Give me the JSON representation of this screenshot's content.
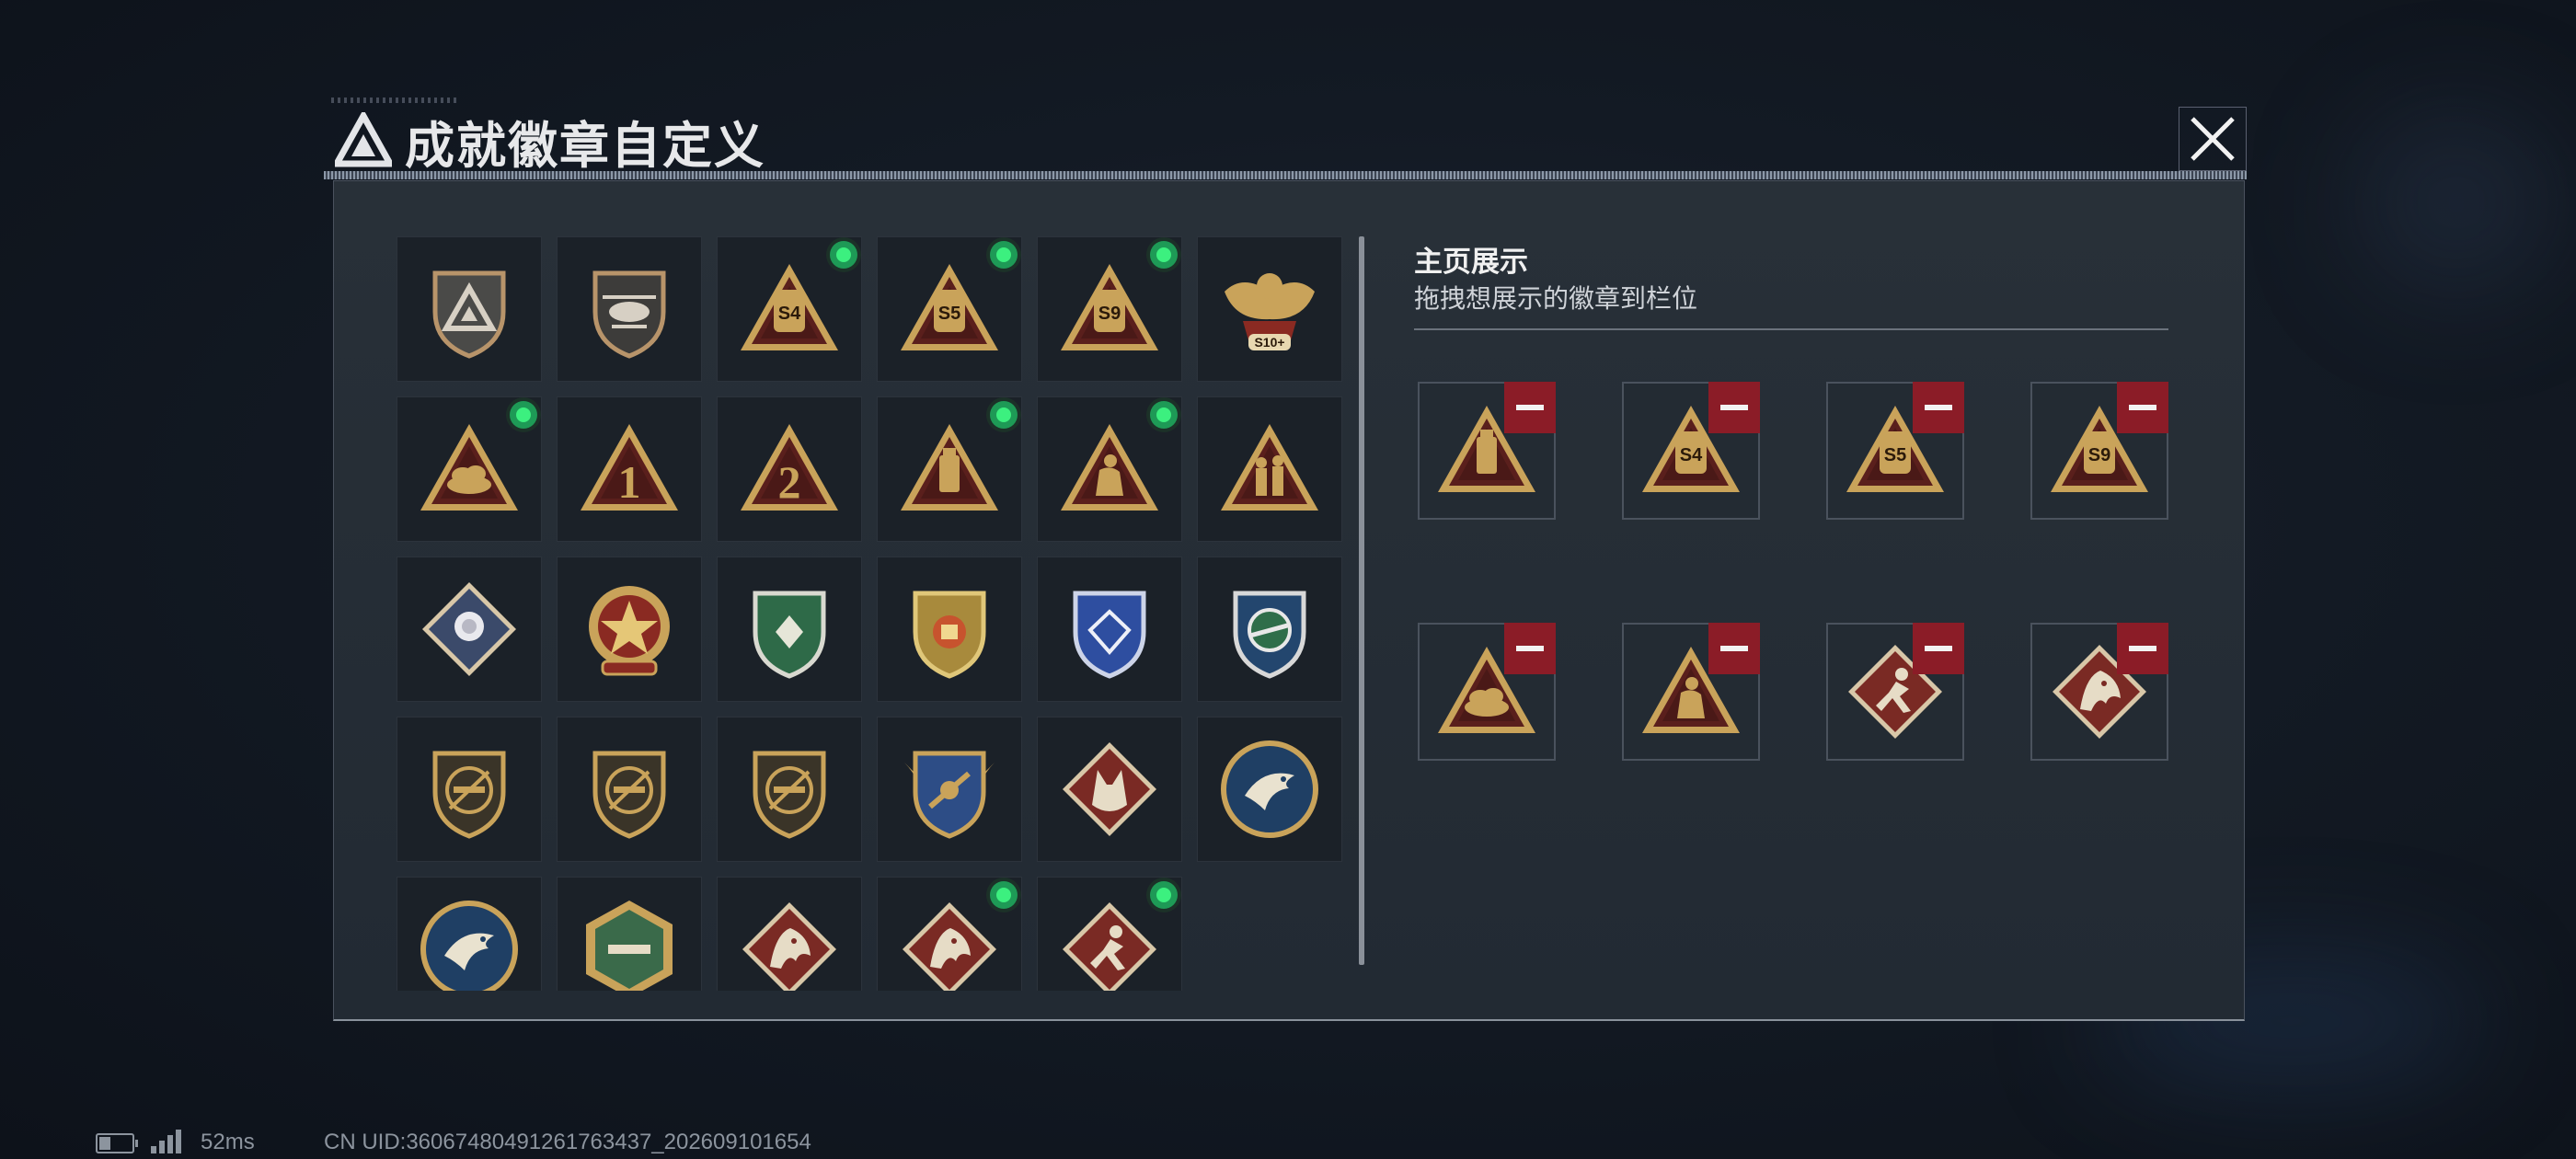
{
  "window": {
    "title": "成就徽章自定义",
    "close_icon": "close-icon"
  },
  "badges": [
    {
      "icon": "shield-logo-badge",
      "new": false
    },
    {
      "icon": "helicopter-shield-badge",
      "new": false
    },
    {
      "icon": "s4-triangle-badge",
      "new": true,
      "label": "S4"
    },
    {
      "icon": "s5-triangle-badge",
      "new": true,
      "label": "S5"
    },
    {
      "icon": "s9-triangle-badge",
      "new": true,
      "label": "S9"
    },
    {
      "icon": "eagle-s10-badge",
      "new": false,
      "label": "S10+"
    },
    {
      "icon": "gold-pile-triangle-badge",
      "new": true
    },
    {
      "icon": "number-one-triangle-badge",
      "new": false,
      "label": "1"
    },
    {
      "icon": "number-two-triangle-badge",
      "new": false,
      "label": "2"
    },
    {
      "icon": "usb-triangle-badge",
      "new": true
    },
    {
      "icon": "crouching-figure-triangle-badge",
      "new": true
    },
    {
      "icon": "soldiers-triangle-badge",
      "new": false
    },
    {
      "icon": "white-rose-diamond-badge",
      "new": false
    },
    {
      "icon": "star-medal-badge",
      "new": false
    },
    {
      "icon": "green-shield-badge",
      "new": false
    },
    {
      "icon": "gold-blue-shield-badge",
      "new": false
    },
    {
      "icon": "blue-diamond-shield-badge",
      "new": false
    },
    {
      "icon": "crosshair-rifle-shield-badge",
      "new": false
    },
    {
      "icon": "smg-slash-shield-badge",
      "new": false
    },
    {
      "icon": "rifle-slash-shield-badge",
      "new": false
    },
    {
      "icon": "sniper-slash-shield-badge",
      "new": false
    },
    {
      "icon": "winged-gold-shield-badge",
      "new": false
    },
    {
      "icon": "wolf-diamond-badge",
      "new": false
    },
    {
      "icon": "eagle-circle-badge",
      "new": false
    },
    {
      "icon": "eagle-circle-badge-2",
      "new": false
    },
    {
      "icon": "green-hexagon-badge",
      "new": false
    },
    {
      "icon": "dragon-diamond-badge",
      "new": false
    },
    {
      "icon": "dragon-diamond-badge-2",
      "new": true
    },
    {
      "icon": "runner-diamond-badge",
      "new": true
    }
  ],
  "showcase": {
    "title": "主页展示",
    "subtitle": "拖拽想展示的徽章到栏位",
    "slots": [
      {
        "icon": "usb-triangle-badge"
      },
      {
        "icon": "s4-triangle-badge",
        "label": "S4"
      },
      {
        "icon": "s5-triangle-badge",
        "label": "S5"
      },
      {
        "icon": "s9-triangle-badge",
        "label": "S9"
      },
      {
        "icon": "gold-pile-triangle-badge"
      },
      {
        "icon": "crouching-figure-triangle-badge"
      },
      {
        "icon": "runner-diamond-badge"
      },
      {
        "icon": "dragon-diamond-badge"
      }
    ]
  },
  "status": {
    "latency": "52ms",
    "uid": "CN UID:36067480491261763437_202609101654"
  },
  "colors": {
    "gold": "#c9a35a",
    "dark_gold": "#8a6a2c",
    "triangle_red": "#5a1f1c",
    "diamond_red": "#7a2a24",
    "new_dot": "#3cf07f",
    "remove_red": "#8b1c27"
  }
}
